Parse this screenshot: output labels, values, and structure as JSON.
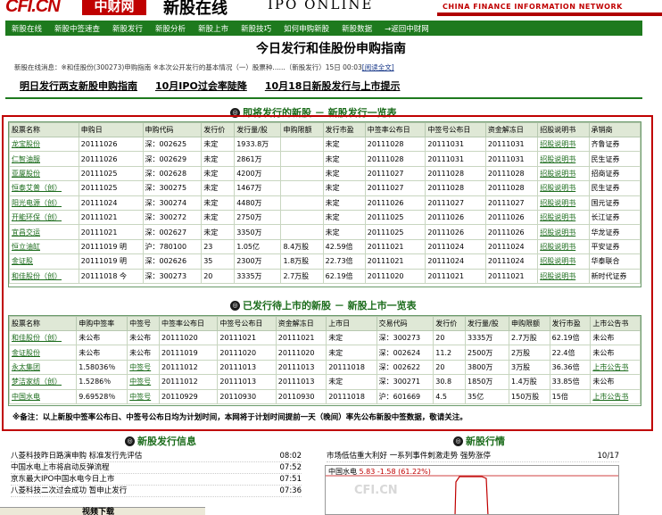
{
  "header": {
    "logo": "CFI.CN",
    "logo_cn": "中财网",
    "site_title": "新股在线",
    "site_sub": "IPO ONLINE",
    "network": "CHINA FINANCE INFORMATION NETWORK"
  },
  "nav": [
    "新股在线",
    "新股中签速查",
    "新股发行",
    "新股分析",
    "新股上市",
    "新股技巧",
    "如何申购新股",
    "新股数据",
    "→返回中财网"
  ],
  "page_title": "今日发行和佳股份申购指南",
  "breadcrumb": {
    "text": "新股在线消息：※和佳股份(300273)申购指南  ※本次公开发行的基本情况（一）股票种......（新股发行）15日 00:03",
    "source": "[阅读全文]"
  },
  "links": [
    "明日发行两支新股申购指南",
    "10月IPO过会率陡降",
    "10月18日新股发行与上市提示"
  ],
  "section1": {
    "title": "即将发行的新股 － 新股发行一览表",
    "headers": [
      "股票名称",
      "申购日",
      "申购代码",
      "发行价",
      "发行量/股",
      "申购限额",
      "发行市盈",
      "中签率公布日",
      "中签号公布日",
      "资金解冻日",
      "招股说明书",
      "承销商"
    ],
    "rows": [
      [
        "龙宝股份",
        "20111026",
        "深：002625",
        "未定",
        "1933.8万",
        "",
        "未定",
        "20111028",
        "20111031",
        "20111031",
        "招股说明书",
        "齐鲁证券"
      ],
      [
        "仁智油服",
        "20111026",
        "深：002629",
        "未定",
        "2861万",
        "",
        "未定",
        "20111028",
        "20111031",
        "20111031",
        "招股说明书",
        "民生证券"
      ],
      [
        "亚厦股份",
        "20111025",
        "深：002628",
        "未定",
        "4200万",
        "",
        "未定",
        "20111027",
        "20111028",
        "20111028",
        "招股说明书",
        "招商证券"
      ],
      [
        "恒泰艾普（创）",
        "20111025",
        "深：300275",
        "未定",
        "1467万",
        "",
        "未定",
        "20111027",
        "20111028",
        "20111028",
        "招股说明书",
        "民生证券"
      ],
      [
        "阳光电源（创）",
        "20111024",
        "深：300274",
        "未定",
        "4480万",
        "",
        "未定",
        "20111026",
        "20111027",
        "20111027",
        "招股说明书",
        "国元证券"
      ],
      [
        "开能环保（创）",
        "20111021",
        "深：300272",
        "未定",
        "2750万",
        "",
        "未定",
        "20111025",
        "20111026",
        "20111026",
        "招股说明书",
        "长江证券"
      ],
      [
        "宜昌交运",
        "20111021",
        "深：002627",
        "未定",
        "3350万",
        "",
        "未定",
        "20111025",
        "20111026",
        "20111026",
        "招股说明书",
        "华龙证券"
      ],
      [
        "恒立油缸",
        "20111019 明",
        "沪：780100",
        "23",
        "1.05亿",
        "8.4万股",
        "42.59倍",
        "20111021",
        "20111024",
        "20111024",
        "招股说明书",
        "平安证券"
      ],
      [
        "金证股",
        "20111019 明",
        "深：002626",
        "35",
        "2300万",
        "1.8万股",
        "22.73倍",
        "20111021",
        "20111024",
        "20111024",
        "招股说明书",
        "华泰联合"
      ],
      [
        "和佳股份（创）",
        "20111018 今",
        "深：300273",
        "20",
        "3335万",
        "2.7万股",
        "62.19倍",
        "20111020",
        "20111021",
        "20111021",
        "招股说明书",
        "新时代证券"
      ]
    ]
  },
  "section2": {
    "title": "已发行待上市的新股 － 新股上市一览表",
    "headers": [
      "股票名称",
      "申购中签率",
      "中签号",
      "中签率公布日",
      "中签号公布日",
      "资金解冻日",
      "上市日",
      "交易代码",
      "发行价",
      "发行量/股",
      "申购限额",
      "发行市盈",
      "上市公告书"
    ],
    "rows": [
      [
        "和佳股份（创）",
        "未公布",
        "未公布",
        "20111020",
        "20111021",
        "20111021",
        "未定",
        "深：300273",
        "20",
        "3335万",
        "2.7万股",
        "62.19倍",
        "未公布"
      ],
      [
        "金证股份",
        "未公布",
        "未公布",
        "20111019",
        "20111020",
        "20111020",
        "未定",
        "深：002624",
        "11.2",
        "2500万",
        "2万股",
        "22.4倍",
        "未公布"
      ],
      [
        "永太集团",
        "1.58036％",
        "中签号",
        "20111012",
        "20111013",
        "20111013",
        "20111018",
        "深：002622",
        "20",
        "3800万",
        "3万股",
        "36.36倍",
        "上市公告书"
      ],
      [
        "梦洁家纺（创）",
        "1.5286％",
        "中签号",
        "20111012",
        "20111013",
        "20111013",
        "未定",
        "深：300271",
        "30.8",
        "1850万",
        "1.4万股",
        "33.85倍",
        "未公布"
      ],
      [
        "中国水电",
        "9.69528％",
        "中签号",
        "20110929",
        "20110930",
        "20110930",
        "20111018",
        "沪：601669",
        "4.5",
        "35亿",
        "150万股",
        "15倍",
        "上市公告书"
      ]
    ]
  },
  "note": "※备注：以上新股中签率公布日、中签号公布日均为计划时间，本网将于计划时间提前一天（晚间）率先公布新股中签数据，敬请关注。",
  "news_left": {
    "title": "新股发行信息",
    "items": [
      [
        "八菱科技昨日路演申购 标准发行先评估",
        "08:02"
      ],
      [
        "中国水电上市将启动反弹流程",
        "07:52"
      ],
      [
        "京东最大IPO中国水电今日上市",
        "07:51"
      ],
      [
        "八菱科技二次过会成功 暂申止发行",
        "07:36"
      ]
    ]
  },
  "news_right": {
    "title": "新股行情",
    "items": [
      [
        "市场低估重大利好 一系列事件刺激走势 强势涨停",
        "10/17"
      ]
    ]
  },
  "chart": {
    "title": "中国水电",
    "value": "5.83",
    "change": "-1.58 (61.22%)",
    "watermark": "CFI.CN"
  },
  "taskbar": "视频下载"
}
